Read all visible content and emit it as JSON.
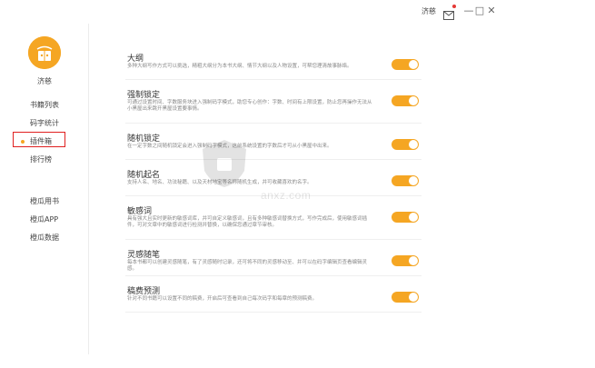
{
  "titlebar": {
    "username": "济慈",
    "mail_icon": "mail-icon",
    "minimize_label": "—",
    "maximize_label": "□",
    "close_label": "✕"
  },
  "sidebar": {
    "avatar_icon": "book-mascot-icon",
    "username": "济慈",
    "top_items": [
      {
        "label": "书籍列表"
      },
      {
        "label": "码字统计"
      },
      {
        "label": "插件箱",
        "active": true
      },
      {
        "label": "排行榜"
      }
    ],
    "bottom_items": [
      {
        "label": "橙瓜用书"
      },
      {
        "label": "橙瓜APP"
      },
      {
        "label": "橙瓜数据"
      }
    ]
  },
  "plugins": [
    {
      "title": "大纲",
      "desc": "多种大纲写作方式可以挑选，精粗大纲分为本书大纲、情节大纲以及人物设置，可帮您理清故事脉络。",
      "enabled": true
    },
    {
      "title": "强制锁定",
      "desc": "可通过设置时间、字数服务块进入强制码字模式，助您专心创作：字数、时间有上限设置，防止您再操作无法从小黑屋出来跳开黑屋设置要事情。",
      "enabled": true
    },
    {
      "title": "随机锁定",
      "desc": "在一定字数之间随机锁定会进入强制码字模式，这前系统设置的字数后才可从小黑屋中出来。",
      "enabled": true
    },
    {
      "title": "随机起名",
      "desc": "支持人名、地名、功法秘籍、以及天材地宝等名称随机生成，并可收藏喜欢的名字。",
      "enabled": true
    },
    {
      "title": "敏感词",
      "desc": "具有强大且实时更新的敏感词库，并可自定义敏感词，且有多种敏感词替换方式，写作完成后，使用敏感词插件，可对文章中的敏感词进行检测并替换，以确保您通过章节审核。",
      "enabled": true
    },
    {
      "title": "灵感随笔",
      "desc": "每本书都可以创建灵感随笔，有了灵感随时记录，还可将不同的灵感移动至、并可以在码字编辑页查看编辑灵感。",
      "enabled": true
    },
    {
      "title": "稿费预测",
      "desc": "针对不同书籍可以设置不同的稿费，开启后可查看到自己每次码字和每章的预测稿费。",
      "enabled": true
    }
  ],
  "watermark": {
    "text": "anxz.com"
  },
  "colors": {
    "accent": "#f5a623",
    "highlight": "#e02020"
  }
}
